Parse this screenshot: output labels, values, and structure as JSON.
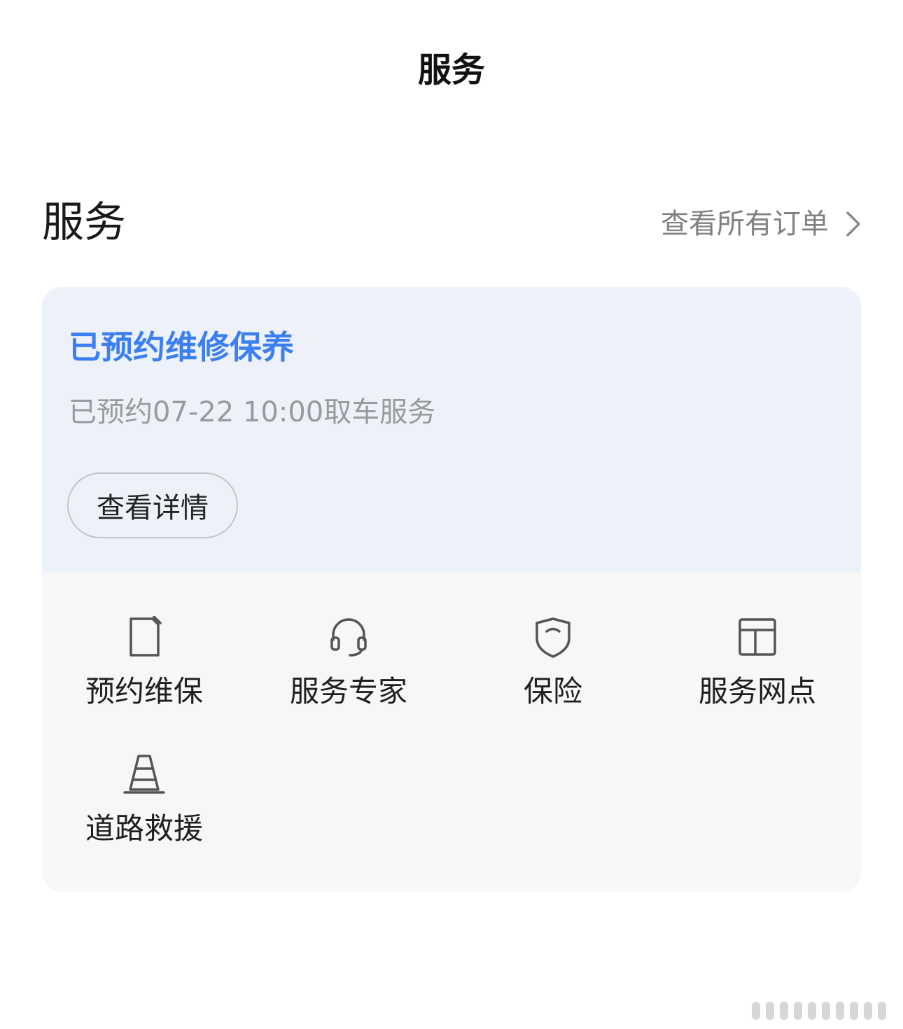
{
  "nav": {
    "title": "服务"
  },
  "section": {
    "title": "服务",
    "all_orders_label": "查看所有订单"
  },
  "booking": {
    "title": "已预约维修保养",
    "subtitle": "已预约07-22 10:00取车服务",
    "detail_button_label": "查看详情"
  },
  "services": [
    {
      "label": "预约维保",
      "icon": "document-icon"
    },
    {
      "label": "服务专家",
      "icon": "headset-icon"
    },
    {
      "label": "保险",
      "icon": "shield-icon"
    },
    {
      "label": "服务网点",
      "icon": "layout-icon"
    },
    {
      "label": "道路救援",
      "icon": "traffic-cone-icon"
    }
  ],
  "colors": {
    "accent": "#3c7ff0",
    "card_top_bg": "#edf1f9",
    "card_bottom_bg": "#f7f7f7",
    "muted_text": "#9a9a9a",
    "icon_stroke": "#555555"
  }
}
